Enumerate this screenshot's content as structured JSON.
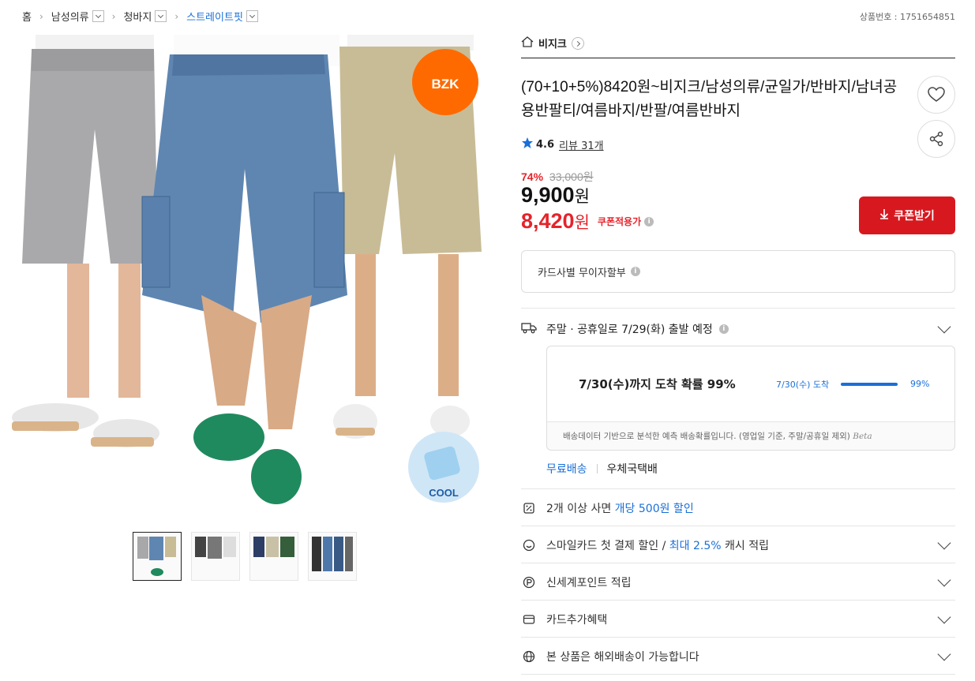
{
  "breadcrumb": {
    "items": [
      "홈",
      "남성의류",
      "청바지",
      "스트레이트핏"
    ]
  },
  "product_no": "상품번호 : 1751654851",
  "shop": {
    "name": "비지크"
  },
  "product": {
    "title": "(70+10+5%)8420원~비지크/남성의류/균일가/반바지/남녀공용반팔티/여름바지/반팔/여름반바지",
    "rating": "4.6",
    "review_text": "리뷰 31개",
    "discount_rate": "74%",
    "original_price": "33,000원",
    "price": "9,900",
    "price_unit": "원",
    "coupon_price": "8,420",
    "coupon_price_unit": "원",
    "coupon_label": "쿠폰적용가"
  },
  "image_overlays": {
    "brand_badge": "BZK",
    "cool_badge": "COOL"
  },
  "buttons": {
    "coupon": "쿠폰받기"
  },
  "card_installment": "카드사별 무이자할부",
  "shipping": {
    "schedule": "주말 · 공휴일로 7/29(화) 출발 예정",
    "prediction_main": "7/30(수)까지 도착 확률 99%",
    "prediction_date": "7/30(수) 도착",
    "prediction_pct": "99%",
    "prediction_note": "배송데이터 기반으로 분석한 예측 배송확률입니다. (영업일 기준, 주말/공휴일 제외)",
    "beta": "Beta",
    "free_shipping": "무료배송",
    "carrier": "우체국택배"
  },
  "benefits": [
    {
      "prefix": "2개 이상 사면 ",
      "highlight": "개당 500원 할인",
      "suffix": ""
    },
    {
      "prefix": "스마일카드 첫 결제 할인 / ",
      "highlight": "최대 2.5%",
      "suffix": " 캐시 적립"
    },
    {
      "prefix": "신세계포인트 적립",
      "highlight": "",
      "suffix": ""
    },
    {
      "prefix": "카드추가혜택",
      "highlight": "",
      "suffix": ""
    },
    {
      "prefix": "본 상품은 해외배송이 가능합니다",
      "highlight": "",
      "suffix": ""
    }
  ],
  "colors": {
    "accent_red": "#e5232b",
    "coupon_button": "#d7191f",
    "link_blue": "#1a6fd8",
    "brand_badge": "#ff6a00"
  }
}
